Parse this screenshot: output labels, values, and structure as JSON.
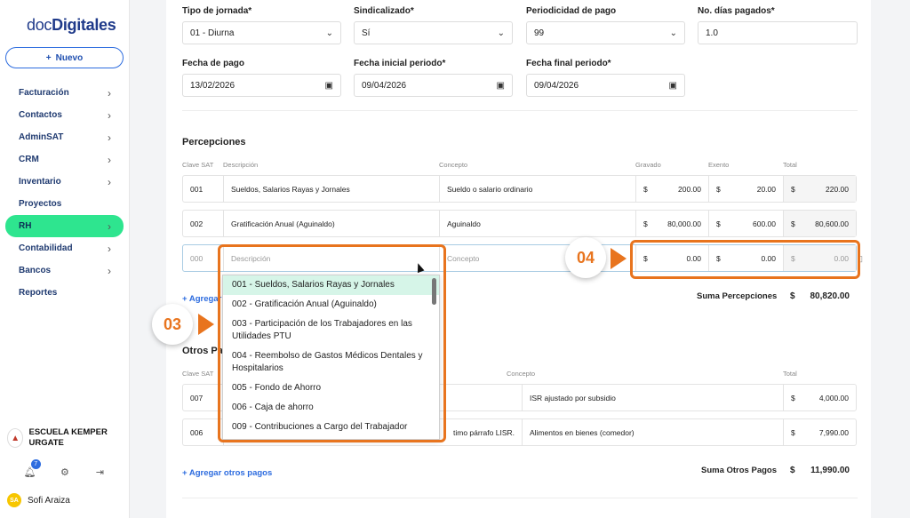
{
  "sidebar": {
    "logo_light": "doc",
    "logo_bold": "Digitales",
    "new_button": "Nuevo",
    "items": [
      {
        "label": "Facturación",
        "chevron": true
      },
      {
        "label": "Contactos",
        "chevron": true
      },
      {
        "label": "AdminSAT",
        "chevron": true
      },
      {
        "label": "CRM",
        "chevron": true
      },
      {
        "label": "Inventario",
        "chevron": true
      },
      {
        "label": "Proyectos",
        "chevron": false
      },
      {
        "label": "RH",
        "chevron": true,
        "active": true
      },
      {
        "label": "Contabilidad",
        "chevron": true
      },
      {
        "label": "Bancos",
        "chevron": true
      },
      {
        "label": "Reportes",
        "chevron": false
      }
    ],
    "org_name": "ESCUELA KEMPER URGATE",
    "notifications_count": "7",
    "user_initials": "SA",
    "user_name": "Sofi Araiza"
  },
  "form": {
    "tipo_jornada_label": "Tipo de jornada*",
    "tipo_jornada_value": "01 - Diurna",
    "sindicalizado_label": "Sindicalizado*",
    "sindicalizado_value": "Sí",
    "periodicidad_label": "Periodicidad de pago",
    "periodicidad_value": "99",
    "dias_label": "No. días pagados*",
    "dias_value": "1.0",
    "fecha_pago_label": "Fecha de pago",
    "fecha_pago_value": "13/02/2026",
    "fecha_inicial_label": "Fecha inicial periodo*",
    "fecha_inicial_value": "09/04/2026",
    "fecha_final_label": "Fecha final periodo*",
    "fecha_final_value": "09/04/2026"
  },
  "percepciones": {
    "title": "Percepciones",
    "headers": [
      "Clave SAT",
      "Descripción",
      "Concepto",
      "Gravado",
      "Exento",
      "Total"
    ],
    "rows": [
      {
        "clave": "001",
        "descripcion": "Sueldos, Salarios Rayas y Jornales",
        "concepto": "Sueldo o salario ordinario",
        "gravado": "200.00",
        "exento": "20.00",
        "total": "220.00"
      },
      {
        "clave": "002",
        "descripcion": "Gratificación Anual (Aguinaldo)",
        "concepto": "Aguinaldo",
        "gravado": "80,000.00",
        "exento": "600.00",
        "total": "80,600.00"
      }
    ],
    "edit_row": {
      "clave_ph": "000",
      "descripcion_ph": "Descripción",
      "concepto_ph": "Concepto",
      "gravado": "0.00",
      "exento": "0.00",
      "total": "0.00"
    },
    "currency": "$",
    "add_link": "+ Agregar",
    "sum_label": "Suma Percepciones",
    "sum_value": "80,820.00"
  },
  "dropdown": {
    "options": [
      "001 - Sueldos, Salarios Rayas y Jornales",
      "002 - Gratificación Anual (Aguinaldo)",
      "003 - Participación de los Trabajadores en las Utilidades PTU",
      "004 - Reembolso de Gastos Médicos Dentales y Hospitalarios",
      "005 - Fondo de Ahorro",
      "006 - Caja de ahorro",
      "009 - Contribuciones a Cargo del Trabajador"
    ]
  },
  "otros_pagos": {
    "title_partial": "Otros Pag",
    "headers": [
      "Clave SAT",
      "Concepto",
      "Total"
    ],
    "rows": [
      {
        "clave": "007",
        "descripcion_tail": "",
        "concepto": "ISR ajustado por subsidio",
        "total": "4,000.00"
      },
      {
        "clave": "006",
        "descripcion_tail": "timo párrafo LISR.",
        "concepto": "Alimentos en bienes (comedor)",
        "total": "7,990.00"
      }
    ],
    "add_link": "+ Agregar otros pagos",
    "sum_label": "Suma Otros Pagos",
    "sum_value": "11,990.00"
  },
  "annotations": {
    "step3": "03",
    "step4": "04",
    "accent": "#e8741e"
  }
}
